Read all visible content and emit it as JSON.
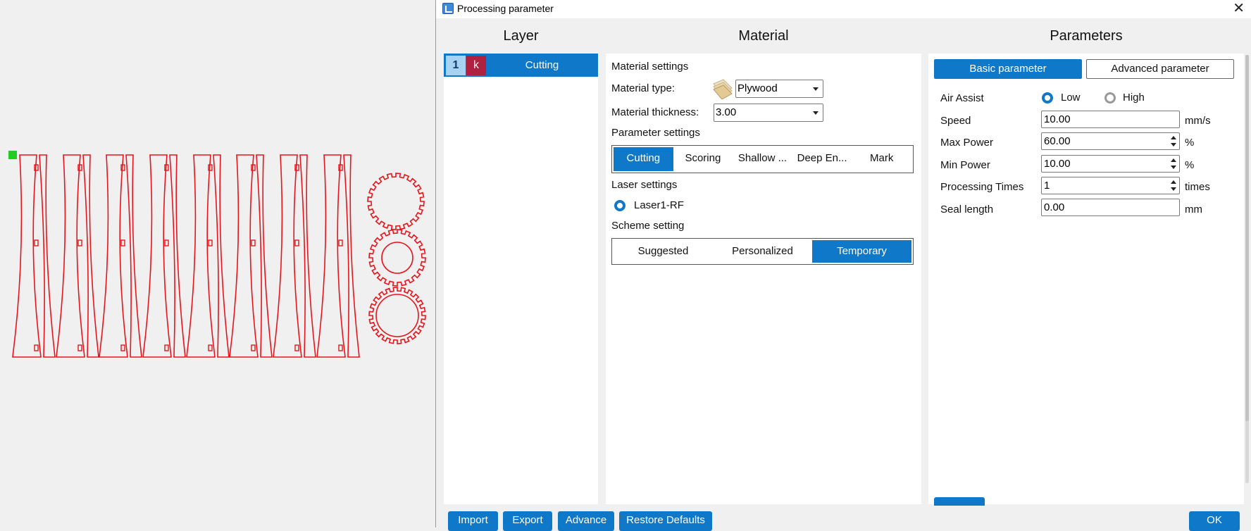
{
  "window": {
    "title": "Processing parameter",
    "close_glyph": "✕"
  },
  "columns": {
    "layer": "Layer",
    "material": "Material",
    "parameters": "Parameters"
  },
  "layer": {
    "number": "1",
    "color_code": "k",
    "name": "Cutting",
    "color": "#b02040"
  },
  "material": {
    "section_title": "Material settings",
    "type_label": "Material type:",
    "type_value": "Plywood",
    "thickness_label": "Material thickness:",
    "thickness_value": "3.00",
    "parameter_settings_title": "Parameter settings",
    "modes": [
      "Cutting",
      "Scoring",
      "Shallow ...",
      "Deep En...",
      "Mark"
    ],
    "active_mode": "Cutting",
    "laser_settings_title": "Laser settings",
    "laser_name": "Laser1-RF",
    "scheme_title": "Scheme setting",
    "schemes": [
      "Suggested",
      "Personalized",
      "Temporary"
    ],
    "active_scheme": "Temporary"
  },
  "parameters": {
    "tabs": {
      "basic": "Basic parameter",
      "advanced": "Advanced parameter"
    },
    "air_assist": {
      "label": "Air Assist",
      "low": "Low",
      "high": "High",
      "selected": "Low"
    },
    "speed": {
      "label": "Speed",
      "value": "10.00",
      "unit": "mm/s"
    },
    "max_power": {
      "label": "Max Power",
      "value": "60.00",
      "unit": "%"
    },
    "min_power": {
      "label": "Min Power",
      "value": "10.00",
      "unit": "%"
    },
    "processing_times": {
      "label": "Processing Times",
      "value": "1",
      "unit": "times"
    },
    "seal_length": {
      "label": "Seal length",
      "value": "0.00",
      "unit": "mm"
    }
  },
  "footer": {
    "import": "Import",
    "export": "Export",
    "advance": "Advance",
    "restore": "Restore Defaults",
    "ok": "OK"
  },
  "colors": {
    "accent": "#0f78c8",
    "cut_line": "#e8141c",
    "origin_marker": "#22cc22"
  }
}
